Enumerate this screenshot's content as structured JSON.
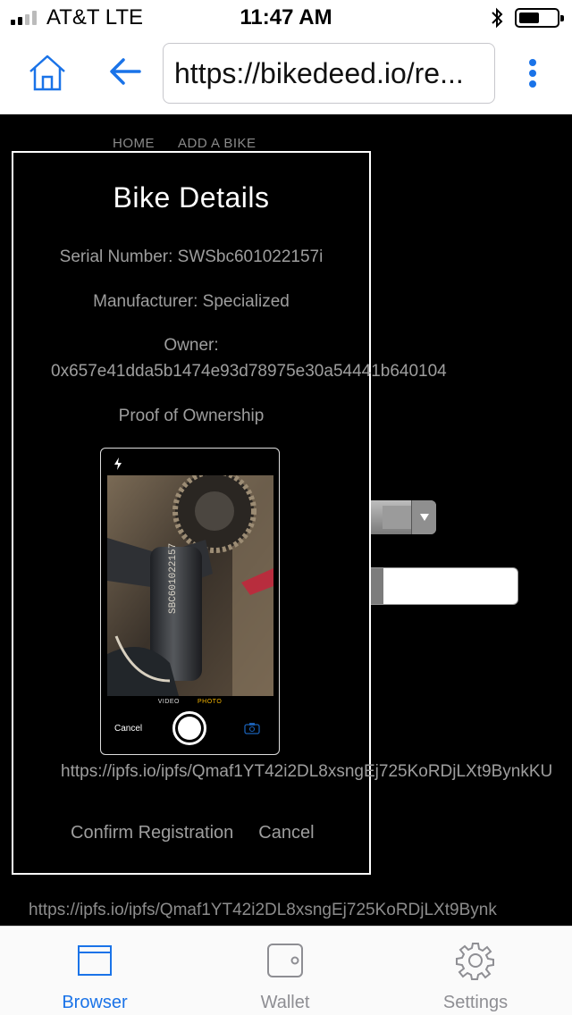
{
  "status_bar": {
    "carrier": "AT&T   LTE",
    "time": "11:47 AM"
  },
  "toolbar": {
    "url": "https://bikedeed.io/re..."
  },
  "site_nav": {
    "home": "HOME",
    "add_bike": "ADD A BIKE"
  },
  "modal": {
    "title": "Bike Details",
    "serial": "Serial Number: SWSbc601022157i",
    "manufacturer": "Manufacturer: Specialized",
    "owner_label": "Owner:",
    "owner_address": "0x657e41dda5b1474e93d78975e30a54441b640104",
    "proof_label": "Proof of Ownership",
    "proof_url": "https://ipfs.io/ipfs/Qmaf1YT42i2DL8xsngEj725KoRDjLXt9BynkKU",
    "confirm_label": "Confirm Registration",
    "cancel_label": "Cancel"
  },
  "camera": {
    "mode_video": "VIDEO",
    "mode_photo": "PHOTO",
    "cancel": "Cancel"
  },
  "background": {
    "ipfs_url": "https://ipfs.io/ipfs/Qmaf1YT42i2DL8xsngEj725KoRDjLXt9Bynk"
  },
  "tabbar": {
    "browser": "Browser",
    "wallet": "Wallet",
    "settings": "Settings",
    "active_color": "#1a73e8",
    "inactive_color": "#8e8e93"
  },
  "icons": {
    "home": "home-icon",
    "back": "arrow-left-icon",
    "menu": "more-vertical-icon",
    "browser": "browser-window-icon",
    "wallet": "wallet-icon",
    "settings": "gear-icon",
    "bluetooth": "bluetooth-icon",
    "battery": "battery-icon",
    "flash": "flash-icon",
    "flip_camera": "flip-camera-icon"
  }
}
